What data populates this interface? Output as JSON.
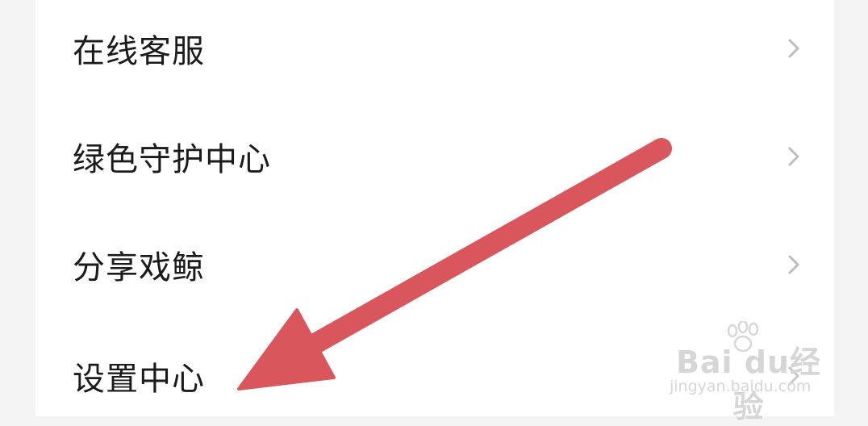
{
  "menu": {
    "items": [
      {
        "label": "在线客服"
      },
      {
        "label": "绿色守护中心"
      },
      {
        "label": "分享戏鲸"
      },
      {
        "label": "设置中心"
      }
    ]
  },
  "annotation": {
    "arrow_color": "#d9575c"
  },
  "watermark": {
    "brand": "Bai du经验",
    "url": "jingyan.baidu.com"
  },
  "icons": {
    "chevron": "chevron-right-icon",
    "arrow": "arrow-annotation-icon",
    "paw": "baidu-paw-icon"
  }
}
